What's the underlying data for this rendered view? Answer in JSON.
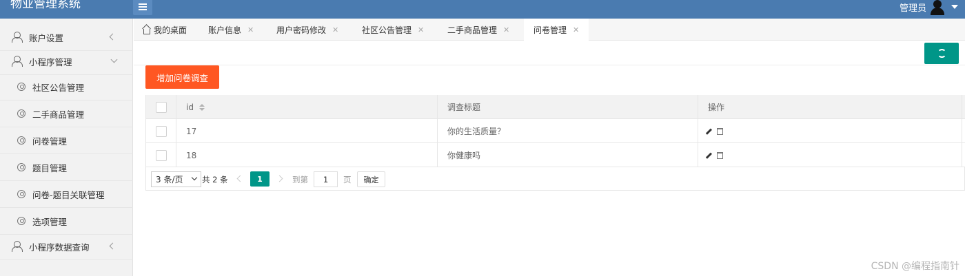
{
  "header": {
    "app_title": "物业管理系统",
    "user_name": "管理员"
  },
  "sidebar": {
    "items": [
      {
        "label": "账户设置",
        "level": "top",
        "icon": "person-icon",
        "indicator": "collapsed"
      },
      {
        "label": "小程序管理",
        "level": "top",
        "icon": "person-icon",
        "indicator": "expanded"
      },
      {
        "label": "社区公告管理",
        "level": "sub",
        "icon": "circle-icon"
      },
      {
        "label": "二手商品管理",
        "level": "sub",
        "icon": "circle-icon"
      },
      {
        "label": "问卷管理",
        "level": "sub",
        "icon": "circle-icon"
      },
      {
        "label": "题目管理",
        "level": "sub",
        "icon": "circle-icon"
      },
      {
        "label": "问卷-题目关联管理",
        "level": "sub",
        "icon": "circle-icon"
      },
      {
        "label": "选项管理",
        "level": "sub",
        "icon": "circle-icon"
      },
      {
        "label": "小程序数据查询",
        "level": "top",
        "icon": "person-icon",
        "indicator": "collapsed"
      }
    ]
  },
  "tabs": [
    {
      "label": "我的桌面",
      "icon": "home-icon"
    },
    {
      "label": "账户信息",
      "close": "✕"
    },
    {
      "label": "用户密码修改",
      "close": "✕"
    },
    {
      "label": "社区公告管理",
      "close": "✕"
    },
    {
      "label": "二手商品管理",
      "close": "✕"
    },
    {
      "label": "问卷管理",
      "close": "✕",
      "active": true
    }
  ],
  "toolbar": {
    "add_label": "增加问卷调查",
    "refresh_icon": "refresh-icon"
  },
  "table": {
    "columns": [
      "id",
      "调查标题",
      "操作"
    ],
    "rows": [
      {
        "id": "17",
        "title": "你的生活质量？"
      },
      {
        "id": "18",
        "title": "你健康吗"
      }
    ]
  },
  "pager": {
    "page_size": "3 条/页",
    "total": "共 2 条",
    "current_page": "1",
    "goto_label": "到第",
    "goto_value": "1",
    "page_unit": "页",
    "confirm_label": "确定"
  },
  "watermark": "CSDN @编程指南针",
  "colors": {
    "header_bg": "#4a7bb0",
    "primary": "#009688",
    "accent": "#ff5722"
  }
}
